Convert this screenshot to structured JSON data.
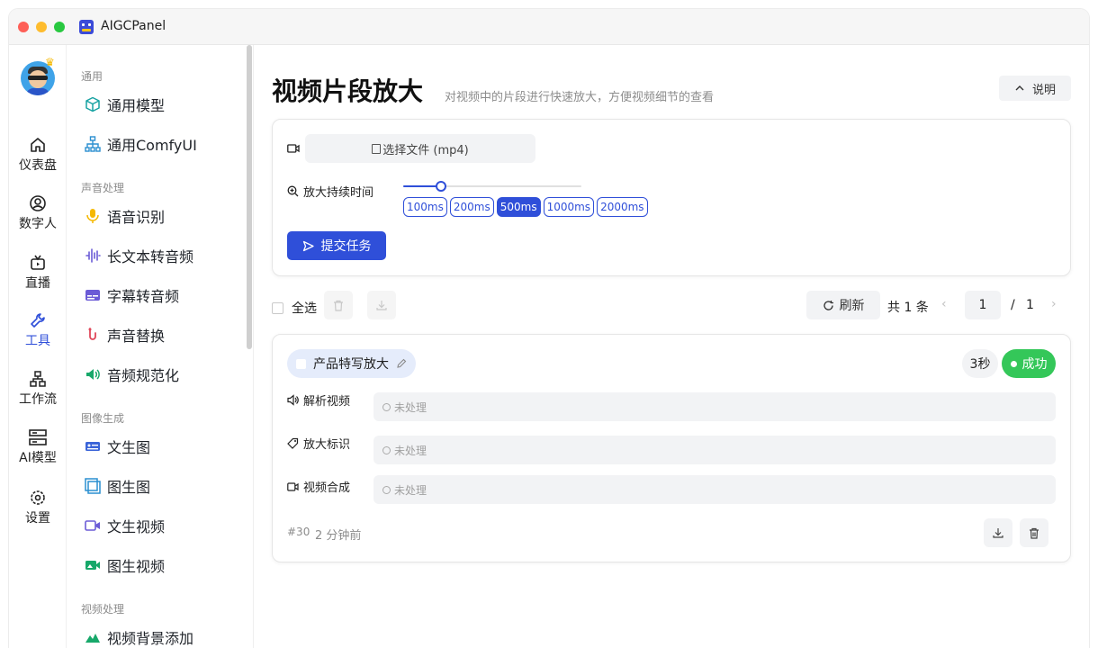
{
  "app": {
    "title": "AIGCPanel"
  },
  "rail": [
    {
      "label": "仪表盘",
      "icon": "home-icon"
    },
    {
      "label": "数字人",
      "icon": "user-circle-icon"
    },
    {
      "label": "直播",
      "icon": "tv-icon"
    },
    {
      "label": "工具",
      "icon": "wrench-icon",
      "active": true
    },
    {
      "label": "工作流",
      "icon": "workflow-icon"
    },
    {
      "label": "AI模型",
      "icon": "server-icon"
    },
    {
      "label": "设置",
      "icon": "gear-icon"
    }
  ],
  "sidebar": {
    "groups": [
      {
        "title": "通用",
        "items": [
          {
            "label": "通用模型",
            "icon": "cube-icon"
          },
          {
            "label": "通用ComfyUI",
            "icon": "hierarchy-icon"
          }
        ]
      },
      {
        "title": "声音处理",
        "items": [
          {
            "label": "语音识别",
            "icon": "microphone-icon"
          },
          {
            "label": "长文本转音频",
            "icon": "waveform-icon"
          },
          {
            "label": "字幕转音频",
            "icon": "subtitle-icon"
          },
          {
            "label": "声音替换",
            "icon": "swap-voice-icon"
          },
          {
            "label": "音频规范化",
            "icon": "speaker-icon"
          }
        ]
      },
      {
        "title": "图像生成",
        "items": [
          {
            "label": "文生图",
            "icon": "text-image-icon"
          },
          {
            "label": "图生图",
            "icon": "image-image-icon"
          },
          {
            "label": "文生视频",
            "icon": "video-camera-icon"
          },
          {
            "label": "图生视频",
            "icon": "image-video-icon"
          }
        ]
      },
      {
        "title": "视频处理",
        "items": [
          {
            "label": "视频背景添加",
            "icon": "mountain-icon"
          }
        ]
      }
    ]
  },
  "page": {
    "title": "视频片段放大",
    "subtitle": "对视频中的片段进行快速放大，方便视频细节的查看",
    "help_label": "说明"
  },
  "form": {
    "file_button": "选择文件 (mp4)",
    "duration_label": "放大持续时间",
    "duration_options": [
      "100ms",
      "200ms",
      "500ms",
      "1000ms",
      "2000ms"
    ],
    "duration_selected": "500ms",
    "slider_fraction": 0.21,
    "submit_label": "提交任务"
  },
  "toolbar": {
    "select_all": "全选",
    "refresh": "刷新",
    "total": "共 1 条",
    "page": "1",
    "page_sep": "/",
    "page_total": "1"
  },
  "task": {
    "name": "产品特写放大",
    "duration": "3秒",
    "status": "成功",
    "status_color": "#34c759",
    "steps": [
      {
        "label": "解析视频",
        "icon": "speaker-small-icon",
        "value": "未处理"
      },
      {
        "label": "放大标识",
        "icon": "tag-icon",
        "value": "未处理"
      },
      {
        "label": "视频合成",
        "icon": "video-small-icon",
        "value": "未处理"
      }
    ],
    "id": "#30",
    "ago": "2 分钟前"
  },
  "colors": {
    "accent": "#2f4fd9",
    "success": "#34c759"
  }
}
